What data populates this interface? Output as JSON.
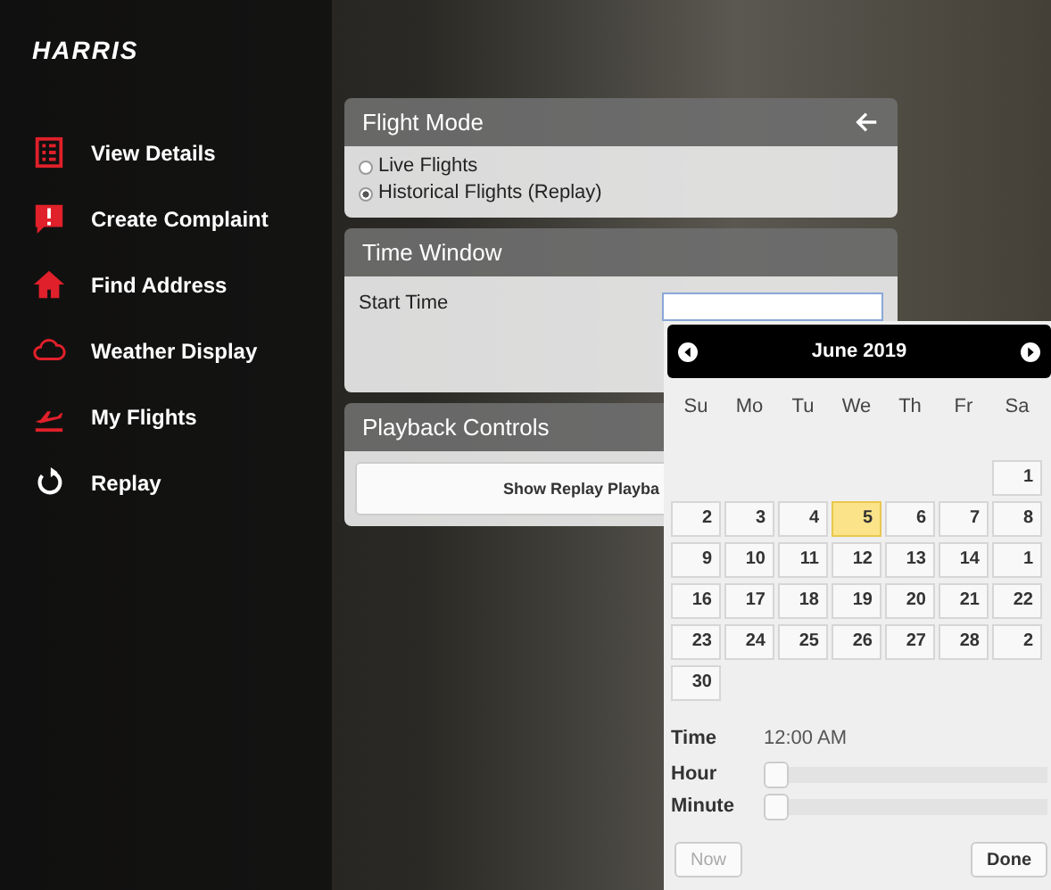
{
  "logo": "HARRIS",
  "sidebar": {
    "items": [
      {
        "label": "View Details"
      },
      {
        "label": "Create Complaint"
      },
      {
        "label": "Find Address"
      },
      {
        "label": "Weather Display"
      },
      {
        "label": "My Flights"
      },
      {
        "label": "Replay"
      }
    ]
  },
  "flight_mode": {
    "title": "Flight Mode",
    "options": [
      {
        "label": "Live Flights",
        "selected": false
      },
      {
        "label": "Historical Flights (Replay)",
        "selected": true
      }
    ]
  },
  "time_window": {
    "title": "Time Window",
    "start_time": {
      "label": "Start Time"
    }
  },
  "playback_controls": {
    "title": "Playback Controls",
    "button": "Show Replay Playba"
  },
  "datepicker": {
    "month": "June 2019",
    "weekdays": [
      "Su",
      "Mo",
      "Tu",
      "We",
      "Th",
      "Fr",
      "Sa"
    ],
    "weeks": [
      [
        {
          "label": "1",
          "selected": false
        }
      ],
      [
        {
          "label": "2",
          "selected": false
        },
        {
          "label": "3",
          "selected": false
        },
        {
          "label": "4",
          "selected": false
        },
        {
          "label": "5",
          "selected": true
        },
        {
          "label": "6",
          "selected": false
        },
        {
          "label": "7",
          "selected": false
        },
        {
          "label": "8",
          "selected": false
        }
      ],
      [
        {
          "label": "9",
          "selected": false
        },
        {
          "label": "10",
          "selected": false
        },
        {
          "label": "11",
          "selected": false
        },
        {
          "label": "12",
          "selected": false
        },
        {
          "label": "13",
          "selected": false
        },
        {
          "label": "14",
          "selected": false
        },
        {
          "label": "1",
          "selected": false
        }
      ],
      [
        {
          "label": "16",
          "selected": false
        },
        {
          "label": "17",
          "selected": false
        },
        {
          "label": "18",
          "selected": false
        },
        {
          "label": "19",
          "selected": false
        },
        {
          "label": "20",
          "selected": false
        },
        {
          "label": "21",
          "selected": false
        },
        {
          "label": "22",
          "selected": false
        }
      ],
      [
        {
          "label": "23",
          "selected": false
        },
        {
          "label": "24",
          "selected": false
        },
        {
          "label": "25",
          "selected": false
        },
        {
          "label": "26",
          "selected": false
        },
        {
          "label": "27",
          "selected": false
        },
        {
          "label": "28",
          "selected": false
        },
        {
          "label": "2",
          "selected": false
        }
      ],
      [
        {
          "label": "30",
          "selected": false
        }
      ]
    ],
    "time_label": "Time",
    "time_value": "12:00 AM",
    "sliders": [
      {
        "label": "Hour",
        "level": 0
      },
      {
        "label": "Minute",
        "level": 0
      }
    ],
    "buttons": [
      "Now",
      "Done"
    ]
  }
}
